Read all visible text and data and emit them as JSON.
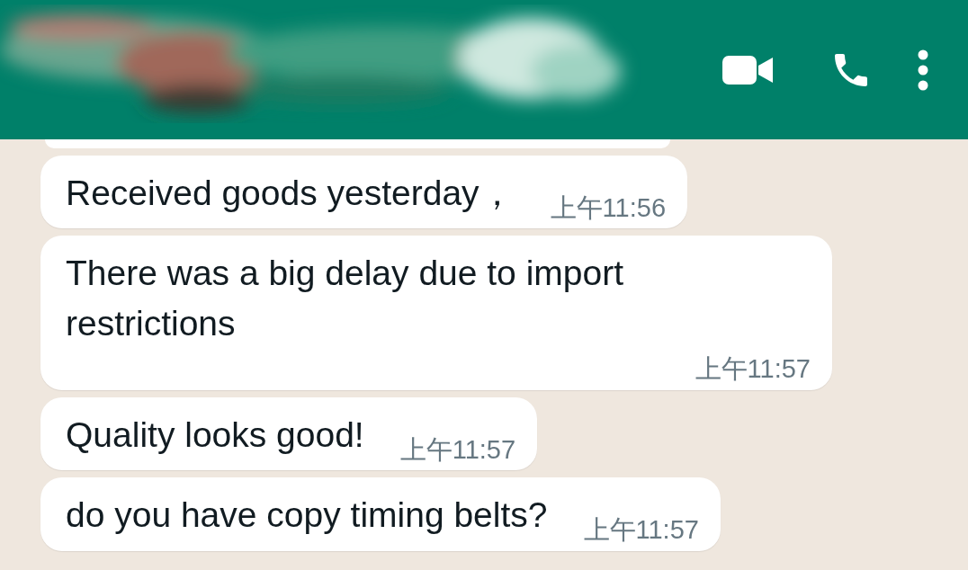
{
  "messages": [
    {
      "text": "Received goods yesterday，",
      "time": "上午11:56"
    },
    {
      "text": "There was a big delay due to import restrictions",
      "time": "上午11:57"
    },
    {
      "text": "Quality looks good!",
      "time": "上午11:57"
    },
    {
      "text": "do you have copy timing belts?",
      "time": "上午11:57"
    }
  ]
}
